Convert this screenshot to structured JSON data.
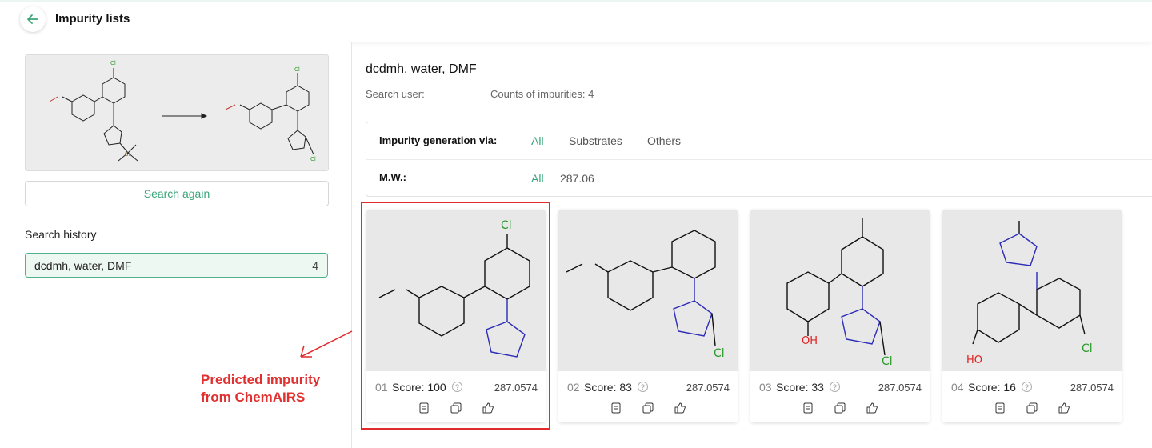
{
  "header": {
    "title": "Impurity lists"
  },
  "sidebar": {
    "search_again_label": "Search again",
    "history_title": "Search history",
    "history": [
      {
        "label": "dcdmh, water, DMF",
        "count": "4"
      }
    ]
  },
  "reaction": {
    "reactant_labels": {
      "cl": "Cl",
      "si": "Si"
    },
    "product_labels": {
      "cl_top": "Cl",
      "cl_bottom": "Cl"
    }
  },
  "annotation": {
    "line1": "Predicted impurity",
    "line2": "from ChemAIRS"
  },
  "main": {
    "title": "dcdmh, water, DMF",
    "search_user_label": "Search user:",
    "counts_label": "Counts of impurities: 4"
  },
  "filters": {
    "generation_label": "Impurity generation via:",
    "generation_options": [
      "All",
      "Substrates",
      "Others"
    ],
    "mw_label": "M.W.:",
    "mw_options": [
      "All",
      "287.06"
    ]
  },
  "cards": [
    {
      "index": "01",
      "score": "Score: 100",
      "mw": "287.0574",
      "labels": {
        "cl": "Cl"
      }
    },
    {
      "index": "02",
      "score": "Score: 83",
      "mw": "287.0574",
      "labels": {
        "cl": "Cl"
      }
    },
    {
      "index": "03",
      "score": "Score: 33",
      "mw": "287.0574",
      "labels": {
        "oh": "OH",
        "cl": "Cl"
      }
    },
    {
      "index": "04",
      "score": "Score: 16",
      "mw": "287.0574",
      "labels": {
        "ho": "HO",
        "cl": "Cl"
      }
    }
  ],
  "colors": {
    "accent": "#3aa57a",
    "highlight": "#e02b2b",
    "nitrogen": "#2b2bb8",
    "oxygen": "#e02020",
    "chlorine": "#2a9a2a"
  }
}
